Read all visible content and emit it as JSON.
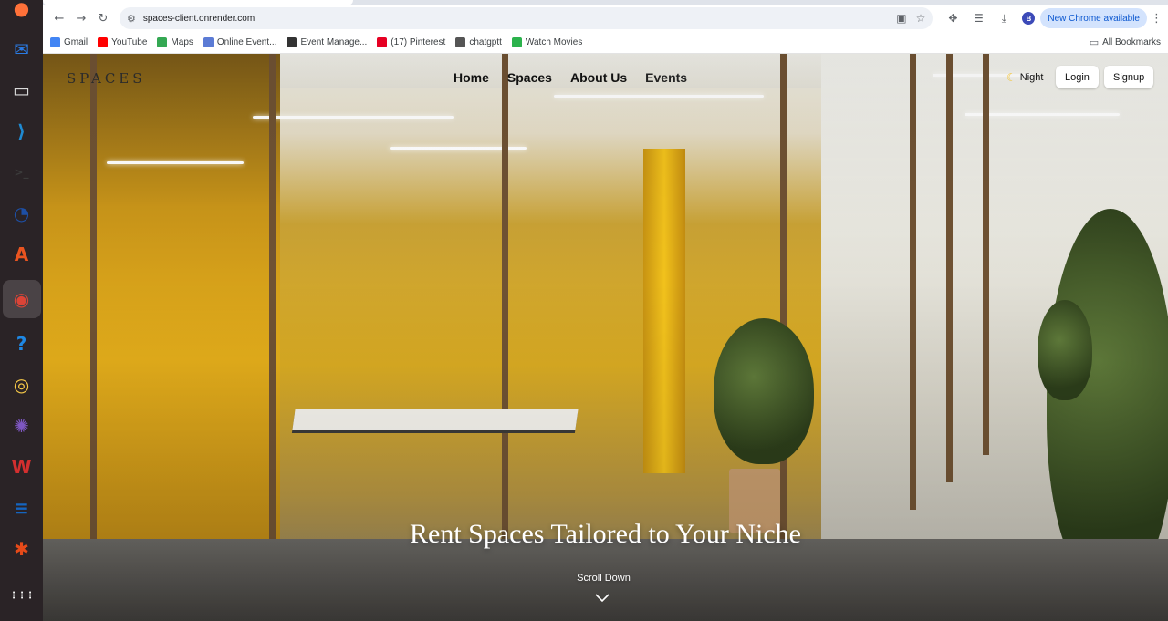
{
  "dock": {
    "apps": [
      {
        "name": "firefox-icon",
        "glyph": "●",
        "color": "#ff7139"
      },
      {
        "name": "thunderbird-icon",
        "glyph": "✉",
        "color": "#2a7be4"
      },
      {
        "name": "files-icon",
        "glyph": "▭",
        "color": "#d9d9d9"
      },
      {
        "name": "vscode-icon",
        "glyph": "⟩",
        "color": "#1f8ad2"
      },
      {
        "name": "terminal-icon",
        "glyph": ">_",
        "color": "#3b3b3b"
      },
      {
        "name": "timer-icon",
        "glyph": "◔",
        "color": "#1d4fa5"
      },
      {
        "name": "app-center-icon",
        "glyph": "A",
        "color": "#e95420"
      },
      {
        "name": "chrome-icon",
        "glyph": "◉",
        "color": "#db4437"
      },
      {
        "name": "help-icon",
        "glyph": "?",
        "color": "#1e88e5"
      },
      {
        "name": "rhythmbox-icon",
        "glyph": "◎",
        "color": "#f7c948"
      },
      {
        "name": "network-icon",
        "glyph": "✺",
        "color": "#7e57c2"
      },
      {
        "name": "wps-icon",
        "glyph": "W",
        "color": "#d32f2f"
      },
      {
        "name": "writer-icon",
        "glyph": "≡",
        "color": "#1565c0"
      },
      {
        "name": "settings-icon",
        "glyph": "✱",
        "color": "#e64a19"
      }
    ],
    "show_apps": "⋮⋮⋮"
  },
  "browser": {
    "url": "spaces-client.onrender.com",
    "update_label": "New Chrome available",
    "profile_initial": "B",
    "bookmarks": [
      {
        "label": "Gmail",
        "color": "#4285f4"
      },
      {
        "label": "YouTube",
        "color": "#ff0000"
      },
      {
        "label": "Maps",
        "color": "#34a853"
      },
      {
        "label": "Online Event...",
        "color": "#5b7bd5"
      },
      {
        "label": "Event Manage...",
        "color": "#333333"
      },
      {
        "label": "(17) Pinterest",
        "color": "#e60023"
      },
      {
        "label": "chatgptt",
        "color": "#555555"
      },
      {
        "label": "Watch Movies",
        "color": "#2bb24c"
      }
    ],
    "all_bookmarks": "All Bookmarks"
  },
  "site": {
    "logo": "SPACES",
    "nav": [
      "Home",
      "Spaces",
      "About Us",
      "Events"
    ],
    "theme_label": "Night",
    "login": "Login",
    "signup": "Signup",
    "headline": "Rent Spaces Tailored to Your Niche",
    "scroll_label": "Scroll Down"
  }
}
